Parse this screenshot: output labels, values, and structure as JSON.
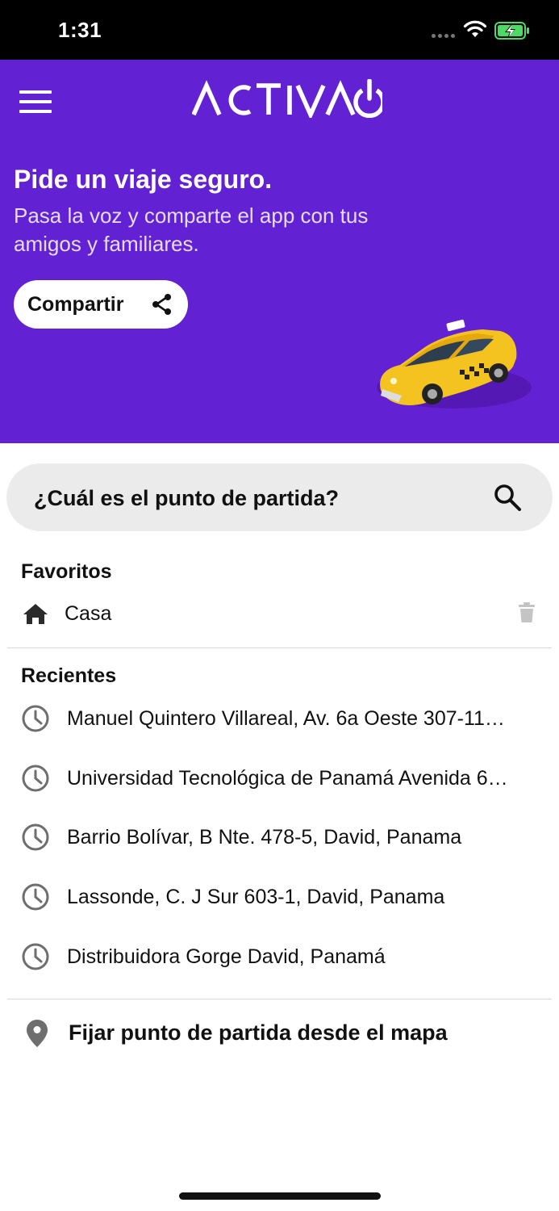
{
  "status_bar": {
    "time": "1:31"
  },
  "header": {
    "brand": "ACTIVAO"
  },
  "hero": {
    "title": "Pide un viaje seguro.",
    "subtitle": "Pasa la voz y comparte el app con tus amigos y familiares.",
    "share_label": "Compartir"
  },
  "search": {
    "placeholder": "¿Cuál es el punto de partida?"
  },
  "favorites": {
    "title": "Favoritos",
    "items": [
      {
        "label": "Casa",
        "icon": "home-icon"
      }
    ]
  },
  "recents": {
    "title": "Recientes",
    "items": [
      {
        "label": "Manuel Quintero Villareal, Av. 6a Oeste 307-11…"
      },
      {
        "label": "Universidad Tecnológica de Panamá Avenida 6…"
      },
      {
        "label": "Barrio Bolívar, B Nte. 478-5, David, Panama"
      },
      {
        "label": "Lassonde, C. J Sur 603-1, David, Panama"
      },
      {
        "label": "Distribuidora Gorge David, Panamá"
      }
    ]
  },
  "map_pin": {
    "label": "Fijar punto de partida desde el mapa"
  },
  "colors": {
    "brand_purple": "#6222d3",
    "search_bg": "#ebebeb",
    "icon_gray": "#6e6e6e",
    "battery_green": "#4cd964"
  }
}
